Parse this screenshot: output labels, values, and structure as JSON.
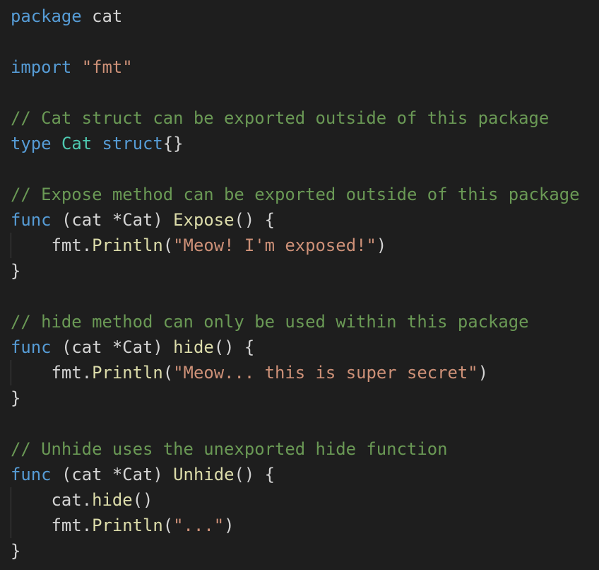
{
  "code": {
    "package_kw": "package",
    "package_name": "cat",
    "import_kw": "import",
    "import_path": "\"fmt\"",
    "comment_struct": "// Cat struct can be exported outside of this package",
    "type_kw": "type",
    "type_name": "Cat",
    "struct_kw": "struct",
    "struct_body": "{}",
    "comment_expose": "// Expose method can be exported outside of this package",
    "func_kw": "func",
    "receiver": "(cat *Cat)",
    "expose_name": "Expose",
    "call_parens": "()",
    "open_brace": "{",
    "close_brace": "}",
    "fmt_pkg": "fmt.",
    "println_name": "Println",
    "open_paren": "(",
    "close_paren": ")",
    "expose_string": "\"Meow! I'm exposed!\"",
    "comment_hide": "// hide method can only be used within this package",
    "hide_name": "hide",
    "hide_string": "\"Meow... this is super secret\"",
    "comment_unhide": "// Unhide uses the unexported hide function",
    "unhide_name": "Unhide",
    "cat_obj": "cat.",
    "ellipsis_string": "\"...\""
  },
  "colors": {
    "background": "#1e1e1e",
    "keyword": "#569cd6",
    "string": "#ce9178",
    "comment": "#6a9955",
    "type": "#4ec9b0",
    "function": "#dcdcaa",
    "plain": "#d4d4d4"
  }
}
